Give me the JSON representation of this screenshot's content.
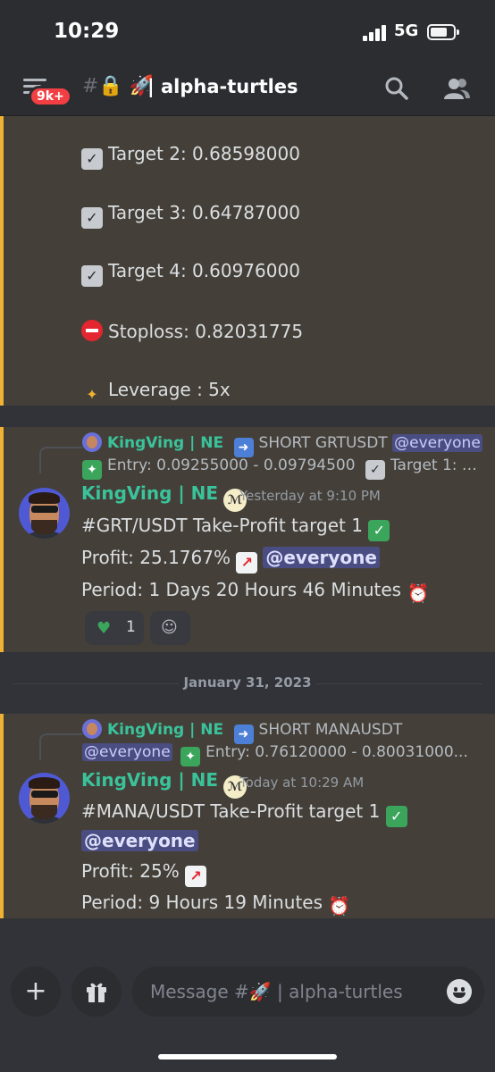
{
  "status_bar": {
    "time": "10:29",
    "network": "5G"
  },
  "header": {
    "badge": "9k+",
    "channel_prefix": "#🔒 🚀",
    "channel_name": "| alpha-turtles"
  },
  "top_message": {
    "lines": [
      "Target 2: 0.68598000",
      "Target 3: 0.64787000",
      "Target 4: 0.60976000",
      "Stoploss: 0.82031775",
      "Leverage : 5x"
    ],
    "icons": [
      "check-emoji",
      "check-emoji",
      "check-emoji",
      "no-entry-emoji",
      "dizzy-emoji"
    ]
  },
  "message1": {
    "reply": {
      "author": "KingVing | NE",
      "text": "SHORT GRTUSDT",
      "mention": "@everyone",
      "line2": "Entry: 0.09255000 - 0.09794500",
      "line2_tail": "Target 1: …"
    },
    "author": "KingVing | NE",
    "timestamp": "Yesterday at 9:10 PM",
    "lines": [
      "#GRT/USDT Take-Profit target 1",
      "Profit: 25.1767%",
      "@everyone",
      "Period: 1 Days 20 Hours 46 Minutes"
    ],
    "reaction_count": "1"
  },
  "date_divider": "January 31, 2023",
  "message2": {
    "reply": {
      "author": "KingVing | NE",
      "text": "SHORT MANAUSDT",
      "mention": "@everyone",
      "line2": "Entry: 0.76120000 - 0.80031000..."
    },
    "author": "KingVing | NE",
    "timestamp": "Today at 10:29 AM",
    "lines": [
      "#MANA/USDT Take-Profit target 1",
      "@everyone",
      "Profit: 25%",
      "Period: 9 Hours 19 Minutes"
    ]
  },
  "composer": {
    "placeholder": "Message #🚀 | alpha-turtles"
  },
  "colors": {
    "accent_author": "#3ac39b",
    "highlight_bg": "#444039",
    "highlight_bar": "#f0b232",
    "mention_bg": "#4a4d82"
  }
}
